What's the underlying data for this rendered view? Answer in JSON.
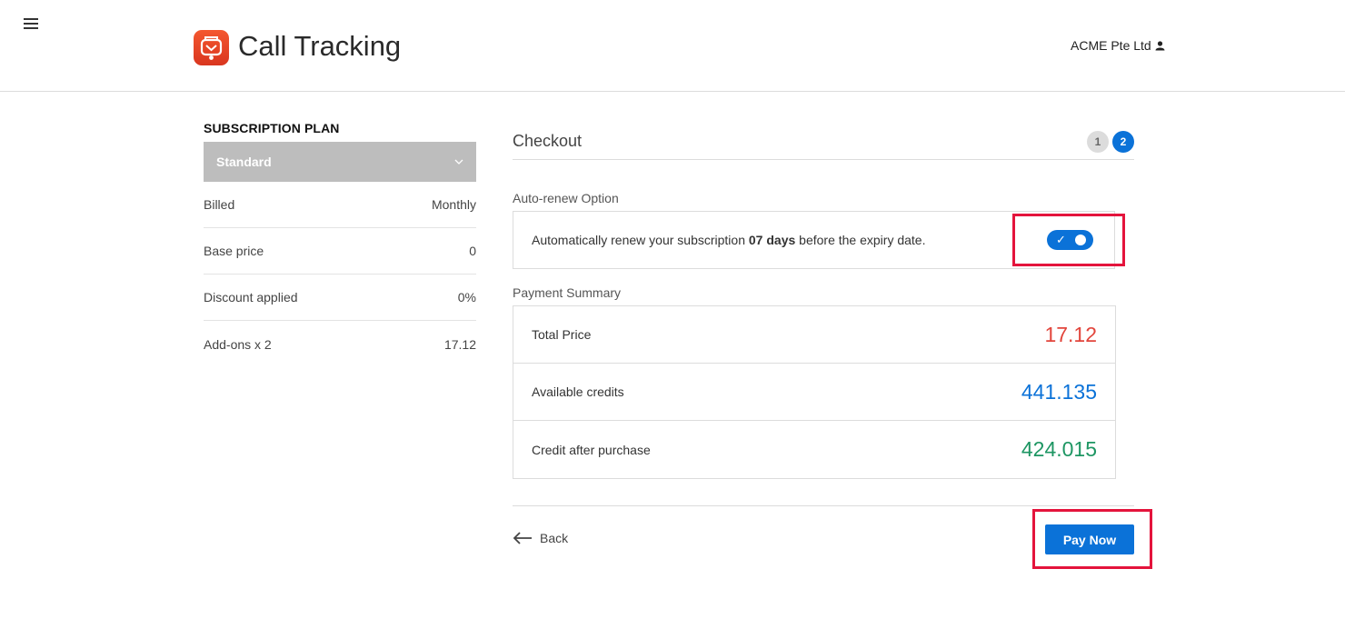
{
  "header": {
    "app_title": "Call Tracking",
    "account_name": "ACME Pte Ltd",
    "menu_icon": "hamburger-menu-icon",
    "logo_icon": "call-tracking-logo",
    "user_icon": "user-icon"
  },
  "plan": {
    "heading": "SUBSCRIPTION PLAN",
    "selected": "Standard",
    "rows": [
      {
        "label": "Billed",
        "value": "Monthly"
      },
      {
        "label": "Base price",
        "value": "0"
      },
      {
        "label": "Discount applied",
        "value": "0%"
      },
      {
        "label": "Add-ons x 2",
        "value": "17.12"
      }
    ]
  },
  "checkout": {
    "title": "Checkout",
    "steps": [
      "1",
      "2"
    ],
    "active_step": "2",
    "renew_label": "Auto-renew Option",
    "renew_text_before": "Automatically renew your subscription ",
    "renew_text_bold": "07 days",
    "renew_text_after": " before the expiry date.",
    "renew_enabled": true,
    "payment_label": "Payment Summary",
    "summary": [
      {
        "label": "Total Price",
        "value": "17.12",
        "color": "#e2453c"
      },
      {
        "label": "Available credits",
        "value": "441.135",
        "color": "#0b72d8"
      },
      {
        "label": "Credit after purchase",
        "value": "424.015",
        "color": "#1e9663"
      }
    ],
    "back_label": "Back",
    "pay_label": "Pay Now"
  },
  "colors": {
    "accent": "#0b72d8",
    "highlight": "#e4143c",
    "logo": "#e8452a"
  }
}
